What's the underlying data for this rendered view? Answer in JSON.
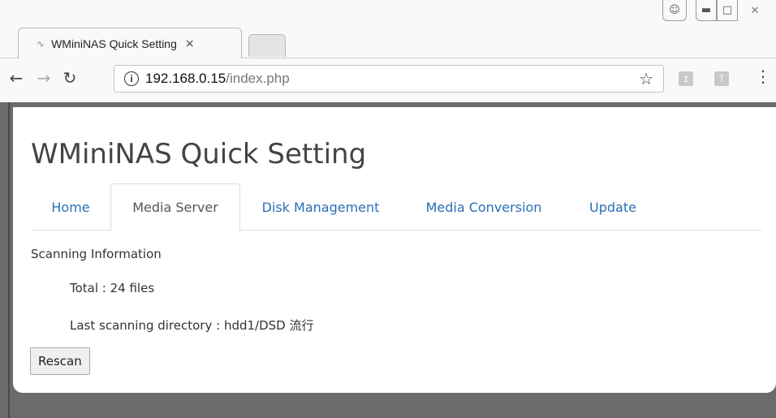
{
  "browser": {
    "tab_title": "WMiniNAS Quick Setting",
    "tab_close": "×",
    "url_host": "192.168.0.15",
    "url_path": "/index.php",
    "icons": [
      "back-arrow-icon",
      "forward-arrow-icon",
      "reload-icon",
      "info-icon",
      "star-icon",
      "pdf-extension-icon",
      "t-extension-icon",
      "menu-icon",
      "user-icon"
    ],
    "ext_t_label": "T"
  },
  "page": {
    "title": "WMiniNAS Quick Setting",
    "tabs": [
      {
        "label": "Home"
      },
      {
        "label": "Media Server"
      },
      {
        "label": "Disk Management"
      },
      {
        "label": "Media Conversion"
      },
      {
        "label": "Update"
      }
    ],
    "active_tab": "Media Server",
    "section_title": "Scanning Information",
    "total_line": "Total : 24 files",
    "last_dir_line": "Last scanning directory : hdd1/DSD 流行",
    "rescan_label": "Rescan"
  },
  "colors": {
    "link": "#2a6fb5",
    "page_bg": "#ffffff",
    "viewport_bg": "#6b6b6b"
  }
}
